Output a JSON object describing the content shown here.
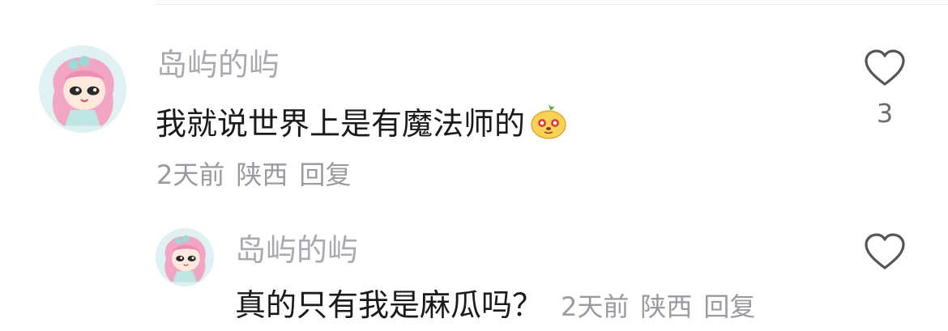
{
  "comments": [
    {
      "username": "岛屿的屿",
      "text": "我就说世界上是有魔法师的",
      "emoji": "cute-mascot-emoji",
      "time": "2天前",
      "location": "陕西",
      "reply_label": "回复",
      "like_count": "3"
    },
    {
      "username": "岛屿的屿",
      "text": "真的只有我是麻瓜吗？",
      "time": "2天前",
      "location": "陕西",
      "reply_label": "回复",
      "like_count": ""
    }
  ],
  "colors": {
    "username": "#a9a9b0",
    "text": "#1a1a1a",
    "meta": "#9a9aa1",
    "avatar_hair": "#f3a6c3"
  }
}
